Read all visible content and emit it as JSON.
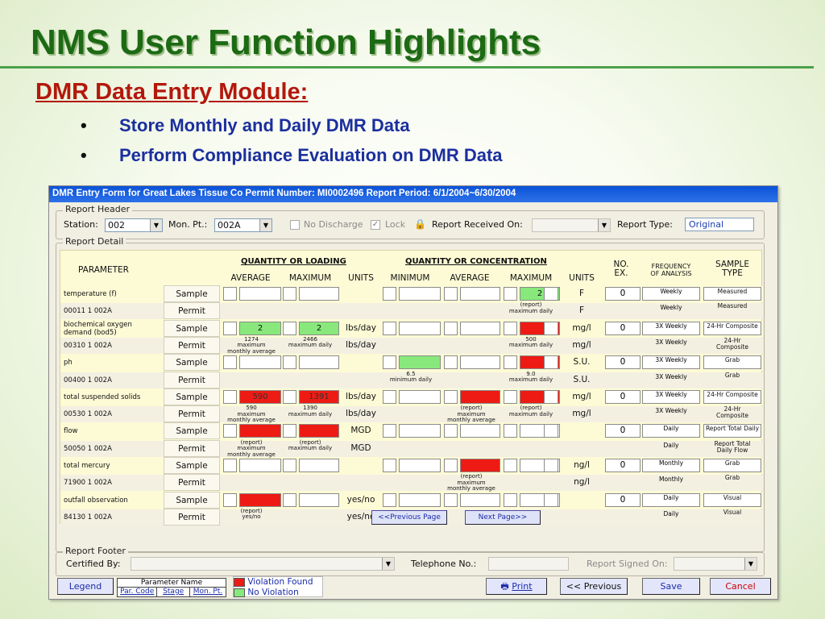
{
  "slide": {
    "title": "NMS User Function Highlights",
    "subtitle": "DMR Data Entry Module:",
    "bullets": [
      "Store Monthly and Daily DMR Data",
      "Perform Compliance Evaluation on DMR Data"
    ]
  },
  "window": {
    "title": "DMR Entry Form for Great Lakes Tissue Co Permit Number: MI0002496 Report Period: 6/1/2004~6/30/2004"
  },
  "header": {
    "legend": "Report Header",
    "station_label": "Station:",
    "station_value": "002",
    "monpt_label": "Mon. Pt.:",
    "monpt_value": "002A",
    "no_discharge": "No Discharge",
    "lock": "Lock",
    "received_label": "Report Received On:",
    "received_value": "",
    "type_label": "Report Type:",
    "type_value": "Original"
  },
  "detail": {
    "legend": "Report Detail",
    "col_parameter": "PARAMETER",
    "grp_loading": "QUANTITY OR LOADING",
    "grp_conc": "QUANTITY OR CONCENTRATION",
    "col_average": "AVERAGE",
    "col_maximum": "MAXIMUM",
    "col_units": "UNITS",
    "col_minimum": "MINIMUM",
    "col_average2": "AVERAGE",
    "col_maximum2": "MAXIMUM",
    "col_units2": "UNITS",
    "col_noex": "NO.\nEX.",
    "col_freq": "FREQUENCY\nOF ANALYSIS",
    "col_sample": "SAMPLE\nTYPE",
    "rows": [
      {
        "param": "temperature (f)",
        "type": "Sample",
        "avg": "",
        "max": "",
        "lunit": "",
        "min": "",
        "cavg": "",
        "cmax": "2",
        "cunit": "F",
        "noex": "0",
        "freq": "Weekly",
        "stype": "Measured"
      },
      {
        "param": "00011 1 002A",
        "type": "Permit",
        "avg": "",
        "max": "",
        "lunit": "",
        "min": "",
        "cavg": "",
        "cmax": "(report)\nmaximum daily",
        "cunit": "F",
        "noex": "",
        "freq": "Weekly",
        "stype": "Measured"
      },
      {
        "param": "biochemical oxygen\ndemand (bod5)",
        "type": "Sample",
        "avg": "2",
        "max": "2",
        "lunit": "lbs/day",
        "min": "",
        "cavg": "",
        "cmax": "",
        "cunit": "mg/l",
        "noex": "0",
        "freq": "3X Weekly",
        "stype": "24-Hr Composite"
      },
      {
        "param": "00310 1 002A",
        "type": "Permit",
        "avg": "1274\nmaximum\nmonthly average",
        "max": "2466\nmaximum daily",
        "lunit": "lbs/day",
        "min": "",
        "cavg": "",
        "cmax": "500\nmaximum daily",
        "cunit": "mg/l",
        "noex": "",
        "freq": "3X Weekly",
        "stype": "24-Hr\nComposite"
      },
      {
        "param": "ph",
        "type": "Sample",
        "avg": "",
        "max": "",
        "lunit": "",
        "min": "",
        "cavg": "",
        "cmax": "",
        "cunit": "S.U.",
        "noex": "0",
        "freq": "3X Weekly",
        "stype": "Grab"
      },
      {
        "param": "00400 1 002A",
        "type": "Permit",
        "avg": "",
        "max": "",
        "lunit": "",
        "min": "6.5\nminimum daily",
        "cavg": "",
        "cmax": "9.0\nmaximum daily",
        "cunit": "S.U.",
        "noex": "",
        "freq": "3X Weekly",
        "stype": "Grab"
      },
      {
        "param": "total suspended solids",
        "type": "Sample",
        "avg": "590",
        "max": "1391",
        "lunit": "lbs/day",
        "min": "",
        "cavg": "",
        "cmax": "",
        "cunit": "mg/l",
        "noex": "0",
        "freq": "3X Weekly",
        "stype": "24-Hr Composite"
      },
      {
        "param": "00530 1 002A",
        "type": "Permit",
        "avg": "590\nmaximum\nmonthly average",
        "max": "1390\nmaximum daily",
        "lunit": "lbs/day",
        "min": "",
        "cavg": "(report)\nmaximum\nmonthly average",
        "cmax": "(report)\nmaximum daily",
        "cunit": "mg/l",
        "noex": "",
        "freq": "3X Weekly",
        "stype": "24-Hr\nComposite"
      },
      {
        "param": "flow",
        "type": "Sample",
        "avg": "",
        "max": "",
        "lunit": "MGD",
        "min": "",
        "cavg": "",
        "cmax": "",
        "cunit": "",
        "noex": "0",
        "freq": "Daily",
        "stype": "Report Total Daily"
      },
      {
        "param": "50050 1 002A",
        "type": "Permit",
        "avg": "(report)\nmaximum\nmonthly average",
        "max": "(report)\nmaximum daily",
        "lunit": "MGD",
        "min": "",
        "cavg": "",
        "cmax": "",
        "cunit": "",
        "noex": "",
        "freq": "Daily",
        "stype": "Report Total\nDaily Flow"
      },
      {
        "param": "total mercury",
        "type": "Sample",
        "avg": "",
        "max": "",
        "lunit": "",
        "min": "",
        "cavg": "",
        "cmax": "",
        "cunit": "ng/l",
        "noex": "0",
        "freq": "Monthly",
        "stype": "Grab"
      },
      {
        "param": "71900 1 002A",
        "type": "Permit",
        "avg": "",
        "max": "",
        "lunit": "",
        "min": "",
        "cavg": "(report)\nmaximum\nmonthly average",
        "cmax": "",
        "cunit": "ng/l",
        "noex": "",
        "freq": "Monthly",
        "stype": "Grab"
      },
      {
        "param": "outfall observation",
        "type": "Sample",
        "avg": "",
        "max": "",
        "lunit": "yes/no",
        "min": "",
        "cavg": "",
        "cmax": "",
        "cunit": "",
        "noex": "0",
        "freq": "Daily",
        "stype": "Visual"
      },
      {
        "param": "84130 1 002A",
        "type": "Permit",
        "avg": "(report)\nyes/no",
        "max": "",
        "lunit": "yes/no",
        "min": "",
        "cavg": "",
        "cmax": "",
        "cunit": "",
        "noex": "",
        "freq": "Daily",
        "stype": "Visual"
      }
    ],
    "prev_page": "<<Previous Page",
    "next_page": "Next Page>>"
  },
  "footer": {
    "legend": "Report Footer",
    "certified_label": "Certified By:",
    "certified_value": "",
    "phone_label": "Telephone No.:",
    "phone_value": "",
    "signed_label": "Report Signed On:",
    "signed_value": ""
  },
  "legend_box": {
    "button": "Legend",
    "param_name": "Parameter Name",
    "par_code": "Par. Code",
    "stage": "Stage",
    "mon_pt": "Mon. Pt.",
    "violation": "Violation Found",
    "no_violation": "No Violation",
    "violation_color": "#ee1b14",
    "ok_color": "#88e87c"
  },
  "buttons": {
    "print": "Print",
    "previous": "<< Previous",
    "save": "Save",
    "cancel": "Cancel"
  }
}
